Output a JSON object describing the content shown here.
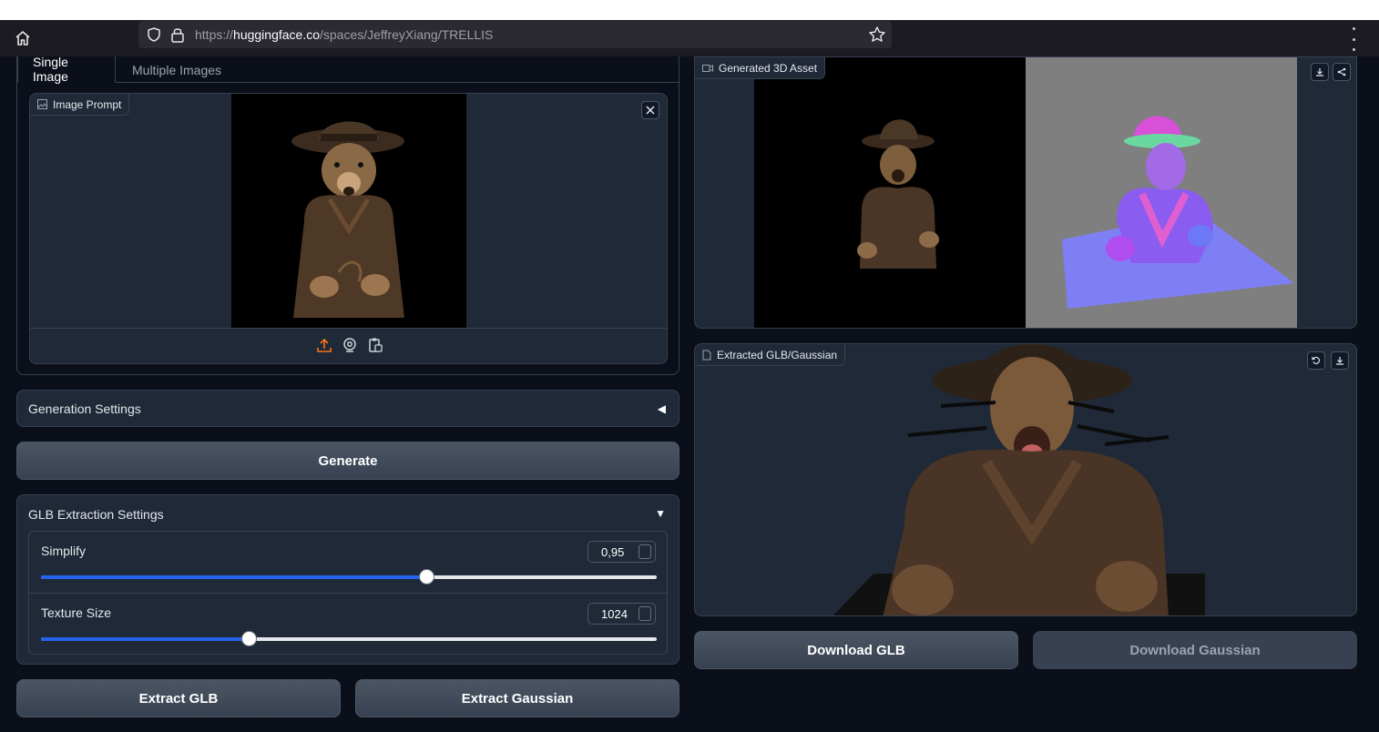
{
  "browser": {
    "url_prefix": "https://",
    "url_domain": "huggingface.co",
    "url_path": "/spaces/JeffreyXiang/TRELLIS"
  },
  "tabs": [
    {
      "label": "Single Image",
      "active": true
    },
    {
      "label": "Multiple Images",
      "active": false
    }
  ],
  "image_prompt": {
    "label": "Image Prompt"
  },
  "generation_settings": {
    "title": "Generation Settings",
    "collapsed": true
  },
  "generate_button": "Generate",
  "glb_settings": {
    "title": "GLB Extraction Settings",
    "collapsed": false,
    "simplify": {
      "label": "Simplify",
      "value": "0,95",
      "fraction": 0.625
    },
    "texture_size": {
      "label": "Texture Size",
      "value": "1024",
      "fraction": 0.337
    }
  },
  "extract_glb_button": "Extract GLB",
  "extract_gaussian_button": "Extract Gaussian",
  "generated_asset": {
    "label": "Generated 3D Asset"
  },
  "extracted": {
    "label": "Extracted GLB/Gaussian"
  },
  "download_glb_button": "Download GLB",
  "download_gaussian_button": "Download Gaussian",
  "colors": {
    "accent": "#2563eb",
    "upload_icon": "#f97316"
  }
}
